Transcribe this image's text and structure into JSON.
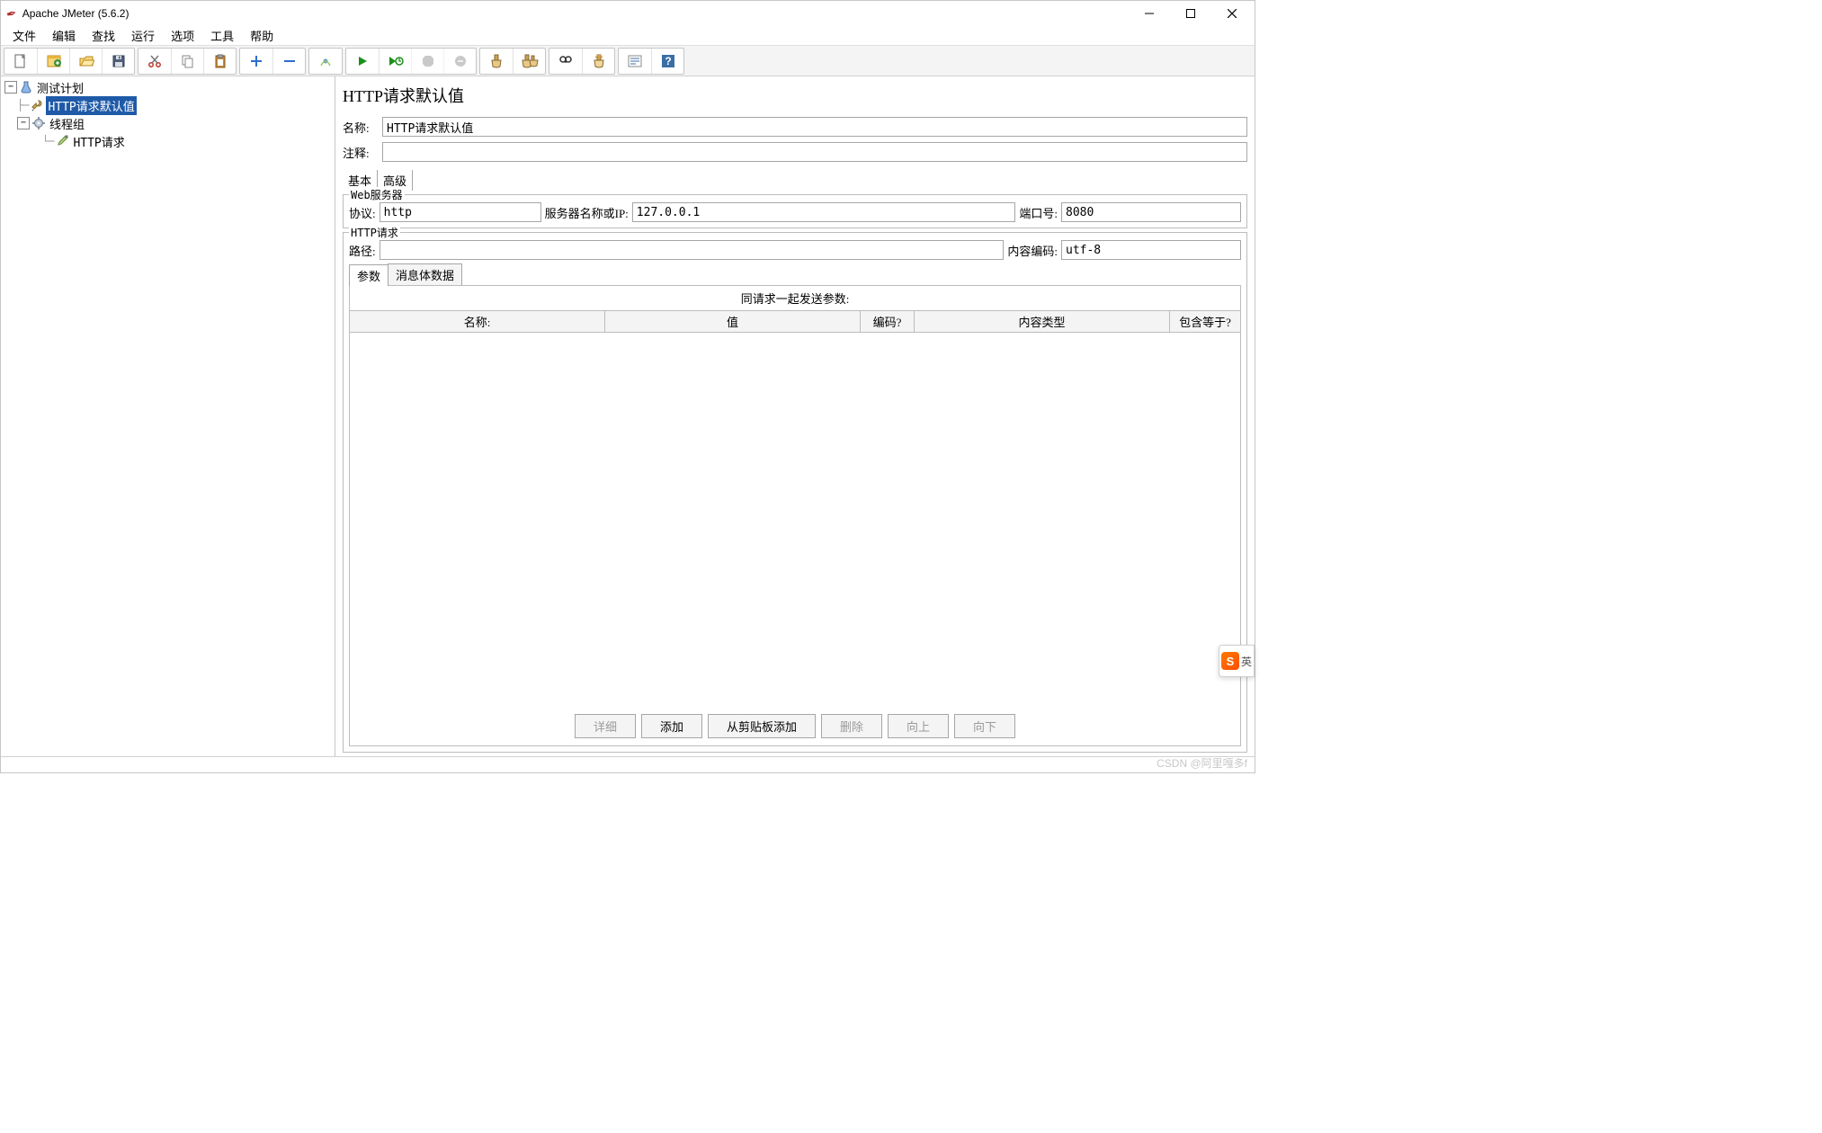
{
  "window": {
    "title": "Apache JMeter (5.6.2)"
  },
  "menu": {
    "items": [
      "文件",
      "编辑",
      "查找",
      "运行",
      "选项",
      "工具",
      "帮助"
    ]
  },
  "toolbar": {
    "g1": [
      "new",
      "templates",
      "open",
      "save"
    ],
    "g2": [
      "cut",
      "copy",
      "paste"
    ],
    "g3": [
      "add",
      "remove"
    ],
    "g4": [
      "reformat"
    ],
    "g5": [
      "start",
      "start-no-timers",
      "stop",
      "shutdown"
    ],
    "g6": [
      "clear",
      "clear-all"
    ],
    "g7": [
      "search",
      "reset-search"
    ],
    "g8": [
      "fn-help",
      "help"
    ]
  },
  "tree": {
    "root": {
      "label": "测试计划",
      "icon": "flask"
    },
    "n1": {
      "label": "HTTP请求默认值",
      "icon": "wrench",
      "selected": true
    },
    "n2": {
      "label": "线程组",
      "icon": "gear"
    },
    "n3": {
      "label": "HTTP请求",
      "icon": "dropper"
    }
  },
  "editor": {
    "title": "HTTP请求默认值",
    "name_label": "名称:",
    "name_value": "HTTP请求默认值",
    "comment_label": "注释:",
    "comment_value": "",
    "tabs": {
      "basic": "基本",
      "advanced": "高级"
    },
    "webserver": {
      "legend": "Web服务器",
      "protocol_label": "协议:",
      "protocol_value": "http",
      "server_label": "服务器名称或IP:",
      "server_value": "127.0.0.1",
      "port_label": "端口号:",
      "port_value": "8080"
    },
    "httpreq": {
      "legend": "HTTP请求",
      "path_label": "路径:",
      "path_value": "",
      "encoding_label": "内容编码:",
      "encoding_value": "utf-8"
    },
    "subtabs": {
      "params": "参数",
      "body": "消息体数据"
    },
    "param_table": {
      "caption": "同请求一起发送参数:",
      "headers": [
        "名称:",
        "值",
        "编码?",
        "内容类型",
        "包含等于?"
      ]
    },
    "buttons": {
      "detail": "详细",
      "add": "添加",
      "from_clip": "从剪贴板添加",
      "delete": "删除",
      "up": "向上",
      "down": "向下"
    }
  },
  "watermark": "CSDN @阿里嘎多f",
  "ime": {
    "logo": "S",
    "lang": "英"
  }
}
